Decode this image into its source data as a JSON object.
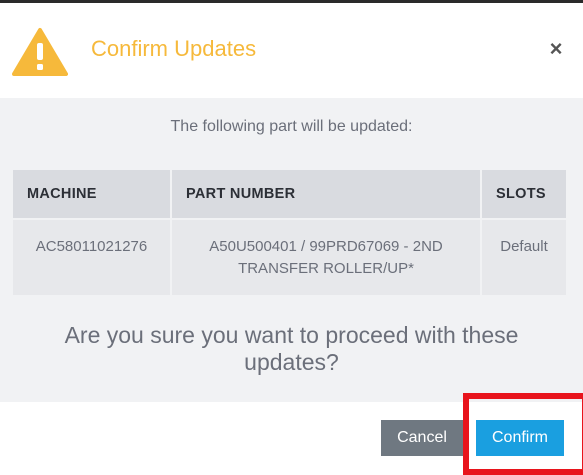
{
  "dialog": {
    "title": "Confirm Updates",
    "close_label": "×",
    "warning_icon": "warning-triangle-icon",
    "accent_color": "#f6b93b"
  },
  "body": {
    "intro": "The following part will be updated:",
    "table": {
      "headers": [
        "MACHINE",
        "PART NUMBER",
        "SLOTS"
      ],
      "rows": [
        {
          "machine": "AC58011021276",
          "part_number_line1": "A50U500401 / 99PRD67069 - 2ND",
          "part_number_line2": "TRANSFER ROLLER/UP*",
          "slots": "Default"
        }
      ]
    },
    "question_line1": "Are you sure you want to proceed with these",
    "question_line2": "updates?"
  },
  "footer": {
    "cancel_label": "Cancel",
    "confirm_label": "Confirm",
    "confirm_color": "#1a9fe0",
    "cancel_color": "#6f7881"
  },
  "annotation": {
    "highlight_color": "#e8141c"
  }
}
